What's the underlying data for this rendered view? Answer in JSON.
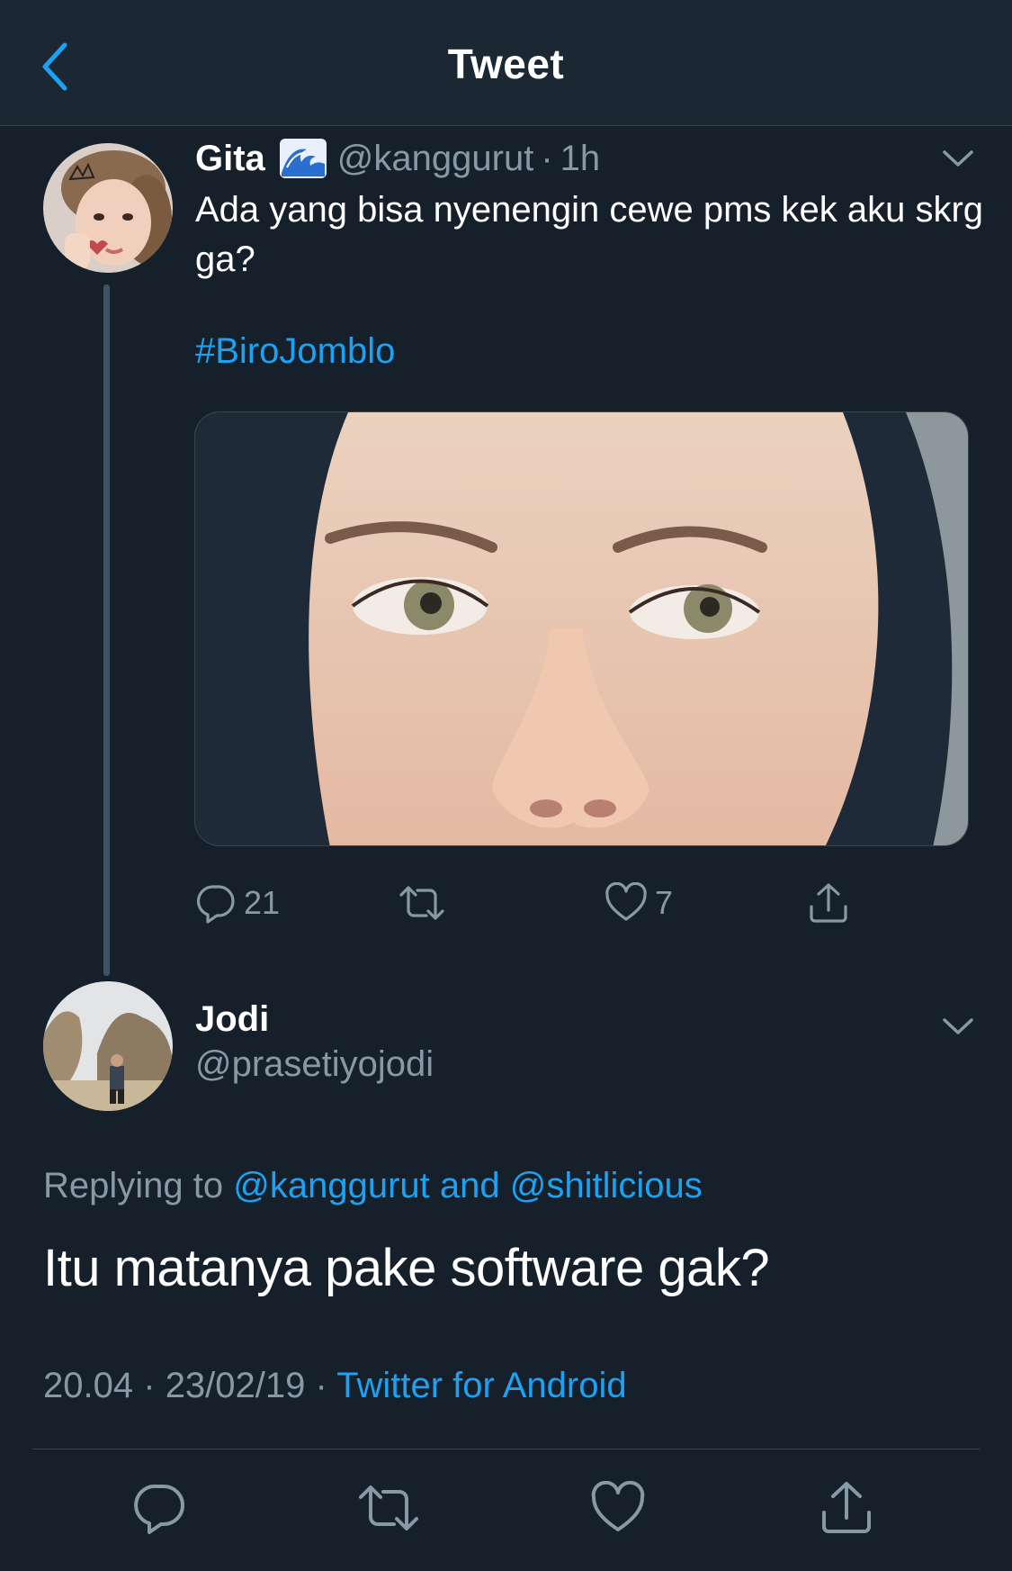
{
  "header": {
    "title": "Tweet",
    "back_icon": "chevron-left-icon"
  },
  "colors": {
    "background": "#15202b",
    "header": "#1b2733",
    "accent": "#1da1f2",
    "secondary": "#8899a6",
    "divider": "#38444d"
  },
  "parent_tweet": {
    "name": "Gita",
    "emoji": "water-wave-emoji",
    "handle": "@kanggurut",
    "separator": "·",
    "time": "1h",
    "text": "Ada yang bisa nyenengin cewe pms kek aku skrg ga?",
    "hashtag": "#BiroJomblo",
    "actions": {
      "reply_count": "21",
      "retweet_count": "",
      "like_count": "7"
    }
  },
  "reply": {
    "name": "Jodi",
    "handle": "@prasetiyojodi",
    "replying_prefix": "Replying to",
    "mention_1": "@kanggurut",
    "mention_and": "and",
    "mention_2": "@shitlicious",
    "text": "Itu matanya pake software gak?",
    "time": "20.04",
    "separator": "·",
    "date": "23/02/19",
    "source": "Twitter for Android"
  },
  "bottom_actions": [
    "reply-icon",
    "retweet-icon",
    "like-icon",
    "share-icon"
  ]
}
